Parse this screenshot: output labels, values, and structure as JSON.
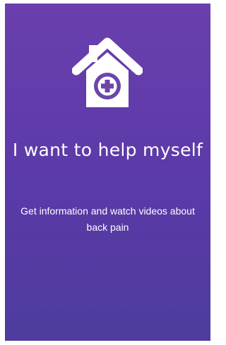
{
  "card": {
    "icon": "house-with-plus-icon",
    "title": "I want to help myself",
    "subtitle": "Get information and watch videos about back pain",
    "background_top": "#6a3fae",
    "background_bottom": "#4e3c9e",
    "text_color": "#ffffff"
  }
}
